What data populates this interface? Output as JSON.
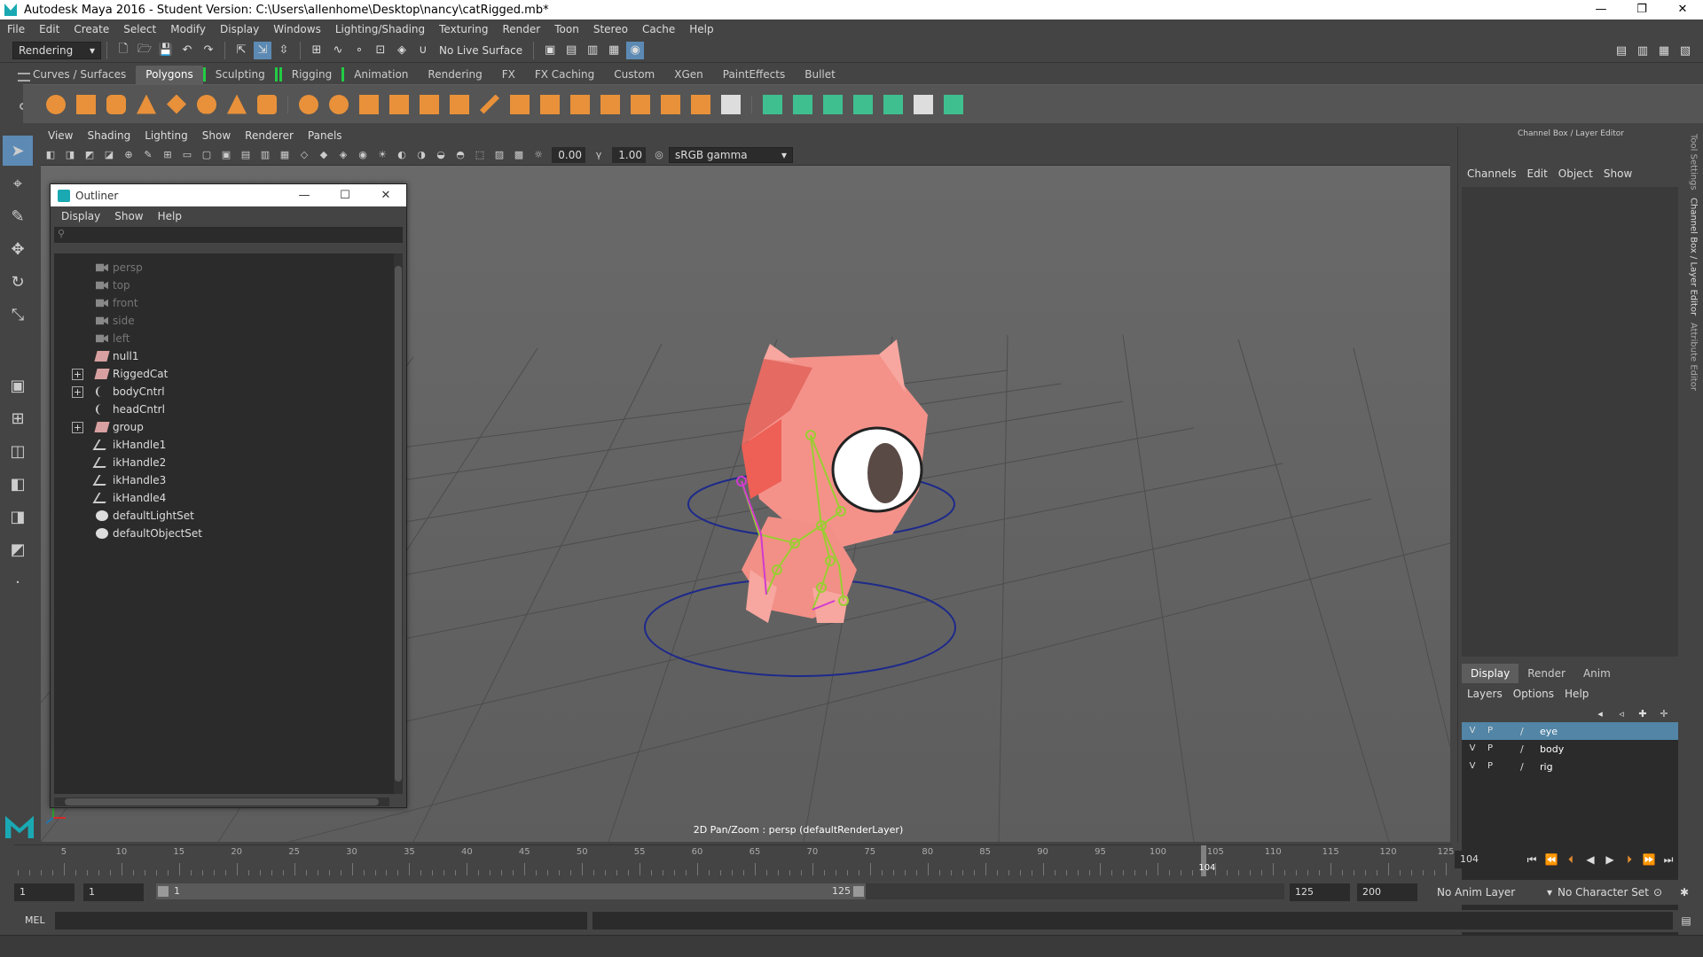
{
  "window": {
    "title": "Autodesk Maya 2016 - Student Version: C:\\Users\\allenhome\\Desktop\\nancy\\catRigged.mb*",
    "minimize": "—",
    "restore": "❐",
    "close": "✕"
  },
  "menubar": [
    "File",
    "Edit",
    "Create",
    "Select",
    "Modify",
    "Display",
    "Windows",
    "Lighting/Shading",
    "Texturing",
    "Render",
    "Toon",
    "Stereo",
    "Cache",
    "Help"
  ],
  "statusline": {
    "menuset": "Rendering",
    "live_surface": "No Live Surface"
  },
  "shelf_tabs": [
    "Curves / Surfaces",
    "Polygons",
    "Sculpting",
    "Rigging",
    "Animation",
    "Rendering",
    "FX",
    "FX Caching",
    "Custom",
    "XGen",
    "PaintEffects",
    "Bullet"
  ],
  "active_shelf_tab": "Polygons",
  "viewport": {
    "menu": [
      "View",
      "Shading",
      "Lighting",
      "Show",
      "Renderer",
      "Panels"
    ],
    "exposure": "0.00",
    "gamma": "1.00",
    "color_space": "sRGB gamma",
    "caption": "2D Pan/Zoom : persp (defaultRenderLayer)"
  },
  "outliner": {
    "title": "Outliner",
    "menu": [
      "Display",
      "Show",
      "Help"
    ],
    "items": [
      {
        "label": "persp",
        "icon": "camera-icon",
        "dim": true,
        "expandable": false
      },
      {
        "label": "top",
        "icon": "camera-icon",
        "dim": true,
        "expandable": false
      },
      {
        "label": "front",
        "icon": "camera-icon",
        "dim": true,
        "expandable": false
      },
      {
        "label": "side",
        "icon": "camera-icon",
        "dim": true,
        "expandable": false
      },
      {
        "label": "left",
        "icon": "camera-icon",
        "dim": true,
        "expandable": false
      },
      {
        "label": "null1",
        "icon": "transform-icon",
        "dim": false,
        "expandable": false
      },
      {
        "label": "RiggedCat",
        "icon": "transform-icon",
        "dim": false,
        "expandable": true
      },
      {
        "label": "bodyCntrl",
        "icon": "curve-icon",
        "dim": false,
        "expandable": true
      },
      {
        "label": "headCntrl",
        "icon": "curve-icon",
        "dim": false,
        "expandable": false
      },
      {
        "label": "group",
        "icon": "transform-icon",
        "dim": false,
        "expandable": true
      },
      {
        "label": "ikHandle1",
        "icon": "ik-handle-icon",
        "dim": false,
        "expandable": false
      },
      {
        "label": "ikHandle2",
        "icon": "ik-handle-icon",
        "dim": false,
        "expandable": false
      },
      {
        "label": "ikHandle3",
        "icon": "ik-handle-icon",
        "dim": false,
        "expandable": false
      },
      {
        "label": "ikHandle4",
        "icon": "ik-handle-icon",
        "dim": false,
        "expandable": false
      },
      {
        "label": "defaultLightSet",
        "icon": "set-icon",
        "dim": false,
        "expandable": false
      },
      {
        "label": "defaultObjectSet",
        "icon": "set-icon",
        "dim": false,
        "expandable": false
      }
    ]
  },
  "channel_box": {
    "title": "Channel Box / Layer Editor",
    "menu": [
      "Channels",
      "Edit",
      "Object",
      "Show"
    ]
  },
  "layer_editor": {
    "tabs": [
      "Display",
      "Render",
      "Anim"
    ],
    "active_tab": "Display",
    "menu": [
      "Layers",
      "Options",
      "Help"
    ],
    "layers": [
      {
        "v": "V",
        "p": "P",
        "name": "eye",
        "selected": true
      },
      {
        "v": "V",
        "p": "P",
        "name": "body",
        "selected": false
      },
      {
        "v": "V",
        "p": "P",
        "name": "rig",
        "selected": false
      }
    ]
  },
  "side_tabs": [
    "Tool Settings",
    "Channel Box / Layer Editor",
    "Attribute Editor"
  ],
  "timeline": {
    "ticks": [
      "5",
      "10",
      "15",
      "20",
      "25",
      "30",
      "35",
      "40",
      "45",
      "50",
      "55",
      "60",
      "65",
      "70",
      "75",
      "80",
      "85",
      "90",
      "95",
      "100",
      "105",
      "110",
      "115",
      "120",
      "125"
    ],
    "start": 1,
    "end": 125,
    "current_frame": "104",
    "current_frame_field": "104"
  },
  "range": {
    "start_time": "1",
    "playback_start": "1",
    "range_start_label": "1",
    "range_end_label": "125",
    "playback_end": "125",
    "end_time": "200",
    "anim_layer": "No Anim Layer",
    "character_set": "No Character Set"
  },
  "command_line": {
    "language": "MEL"
  }
}
